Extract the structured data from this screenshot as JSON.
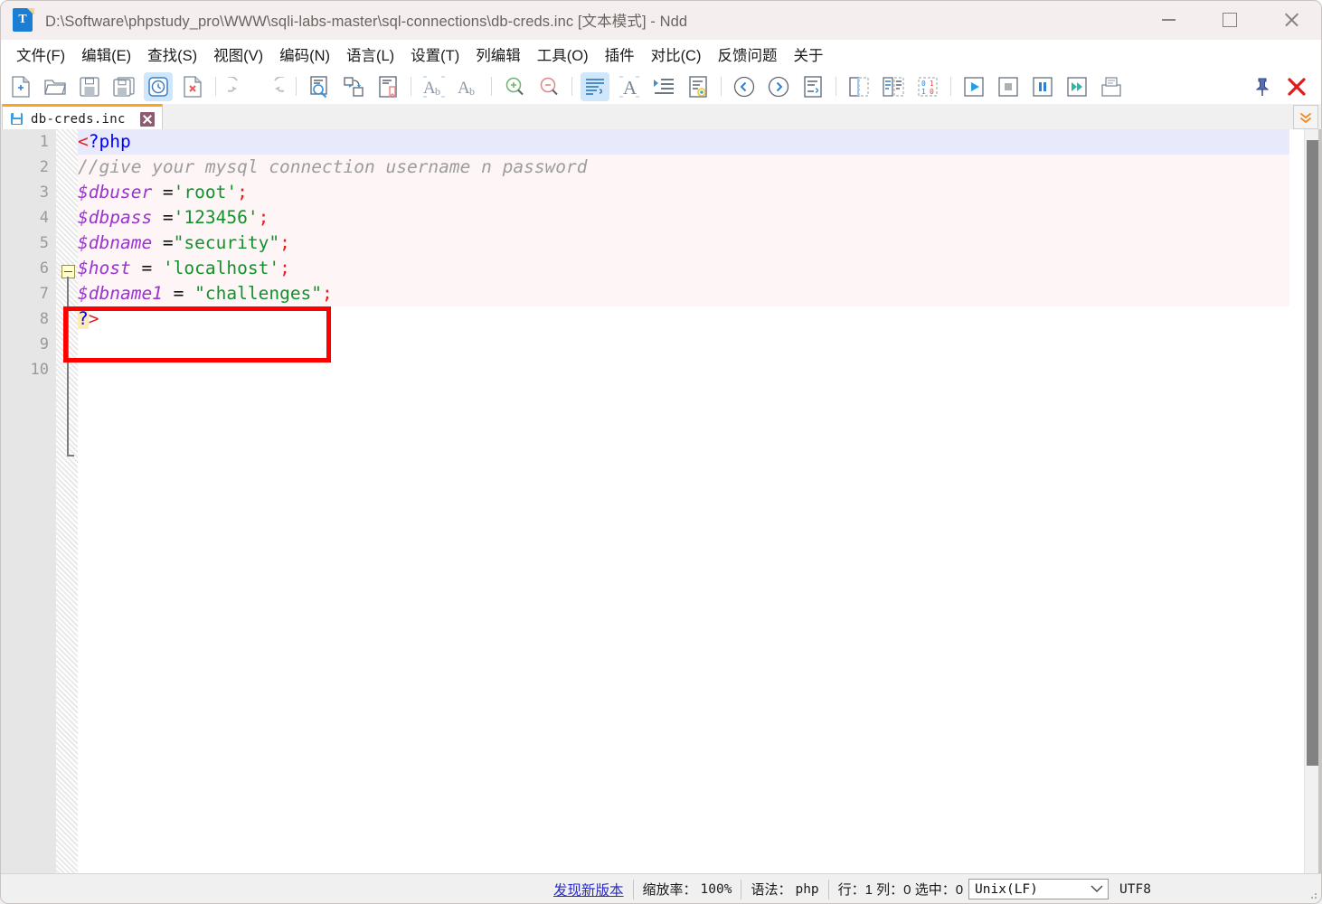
{
  "window": {
    "title": "D:\\Software\\phpstudy_pro\\WWW\\sqli-labs-master\\sql-connections\\db-creds.inc [文本模式] - Ndd",
    "icon": "text-document-icon",
    "icon_letter": "T",
    "controls": {
      "minimize": "minimize-icon",
      "maximize": "maximize-icon",
      "close": "close-icon"
    }
  },
  "menubar": {
    "items": [
      {
        "label": "文件(F)",
        "name": "menu-file"
      },
      {
        "label": "编辑(E)",
        "name": "menu-edit"
      },
      {
        "label": "查找(S)",
        "name": "menu-search"
      },
      {
        "label": "视图(V)",
        "name": "menu-view"
      },
      {
        "label": "编码(N)",
        "name": "menu-encoding"
      },
      {
        "label": "语言(L)",
        "name": "menu-language"
      },
      {
        "label": "设置(T)",
        "name": "menu-settings"
      },
      {
        "label": "列编辑",
        "name": "menu-column-edit"
      },
      {
        "label": "工具(O)",
        "name": "menu-tools"
      },
      {
        "label": "插件",
        "name": "menu-plugins"
      },
      {
        "label": "对比(C)",
        "name": "menu-compare"
      },
      {
        "label": "反馈问题",
        "name": "menu-feedback"
      },
      {
        "label": "关于",
        "name": "menu-about"
      }
    ]
  },
  "toolbar": {
    "icons": [
      "new-file-icon",
      "open-folder-icon",
      "save-icon",
      "save-all-icon",
      "session-clock-icon",
      "close-file-icon",
      "undo-icon",
      "redo-icon",
      "find-in-document-icon",
      "replace-icon",
      "bookmark-icon",
      "lowercase-icon",
      "uppercase-icon",
      "zoom-in-icon",
      "zoom-out-icon",
      "word-wrap-icon",
      "show-all-chars-icon",
      "indent-icon",
      "show-symbol-icon",
      "previous-icon",
      "next-icon",
      "wrap-lines-icon",
      "split-view-icon",
      "compare-icon",
      "binary-icon",
      "run-icon",
      "stop-icon",
      "pause-icon",
      "fast-forward-icon",
      "archive-icon"
    ],
    "active_icon": "session-clock-icon",
    "active_icon_2": "word-wrap-icon",
    "pin": "pin-icon",
    "close_all": "close-all-icon",
    "expand": "double-chevron-down-icon",
    "accent": "#ffa321"
  },
  "tabs": {
    "items": [
      {
        "label": "db-creds.inc",
        "icon": "floppy-save-icon",
        "close": "tab-close-icon",
        "active": true
      }
    ]
  },
  "editor": {
    "gutter_lines": [
      "1",
      "2",
      "3",
      "4",
      "5",
      "6",
      "7",
      "8",
      "9",
      "10"
    ],
    "fold_marker": "fold-collapse-icon",
    "lines": [
      {
        "n": 1,
        "tokens": [
          {
            "t": "<",
            "c": "kw-red"
          },
          {
            "t": "?php",
            "c": "kw-blue"
          }
        ]
      },
      {
        "n": 2,
        "tokens": [
          {
            "t": "//give your mysql connection username n password",
            "c": "kw-cmt"
          }
        ]
      },
      {
        "n": 3,
        "tokens": [
          {
            "t": "$dbuser ",
            "c": "kw-var"
          },
          {
            "t": "=",
            "c": "kw-op"
          },
          {
            "t": "'root'",
            "c": "kw-str"
          },
          {
            "t": ";",
            "c": "kw-semi"
          }
        ]
      },
      {
        "n": 4,
        "tokens": [
          {
            "t": "$dbpass ",
            "c": "kw-var"
          },
          {
            "t": "=",
            "c": "kw-op"
          },
          {
            "t": "'123456'",
            "c": "kw-str"
          },
          {
            "t": ";",
            "c": "kw-semi"
          }
        ]
      },
      {
        "n": 5,
        "tokens": [
          {
            "t": "$dbname ",
            "c": "kw-var"
          },
          {
            "t": "=",
            "c": "kw-op"
          },
          {
            "t": "\"security\"",
            "c": "kw-str"
          },
          {
            "t": ";",
            "c": "kw-semi"
          }
        ]
      },
      {
        "n": 6,
        "tokens": [
          {
            "t": "$host ",
            "c": "kw-var"
          },
          {
            "t": "= ",
            "c": "kw-op"
          },
          {
            "t": "'localhost'",
            "c": "kw-str"
          },
          {
            "t": ";",
            "c": "kw-semi"
          }
        ]
      },
      {
        "n": 7,
        "tokens": [
          {
            "t": "$dbname1 ",
            "c": "kw-var"
          },
          {
            "t": "= ",
            "c": "kw-op"
          },
          {
            "t": "\"challenges\"",
            "c": "kw-str"
          },
          {
            "t": ";",
            "c": "kw-semi"
          }
        ]
      },
      {
        "n": 8,
        "tokens": [
          {
            "t": "?",
            "c": "kw-blue hl-yellow"
          },
          {
            "t": ">",
            "c": "kw-red"
          }
        ]
      }
    ],
    "annotation": {
      "name": "red-highlight-box",
      "color": "#ff0000",
      "covers_lines": "3-4"
    }
  },
  "statusbar": {
    "update_link": "发现新版本",
    "zoom_label": "缩放率：",
    "zoom_value": "100%",
    "syntax_label": "语法：",
    "syntax_value": "php",
    "position": "行：1  列：0  选中：0",
    "eol_value": "Unix(LF)",
    "encoding": "UTF8"
  }
}
